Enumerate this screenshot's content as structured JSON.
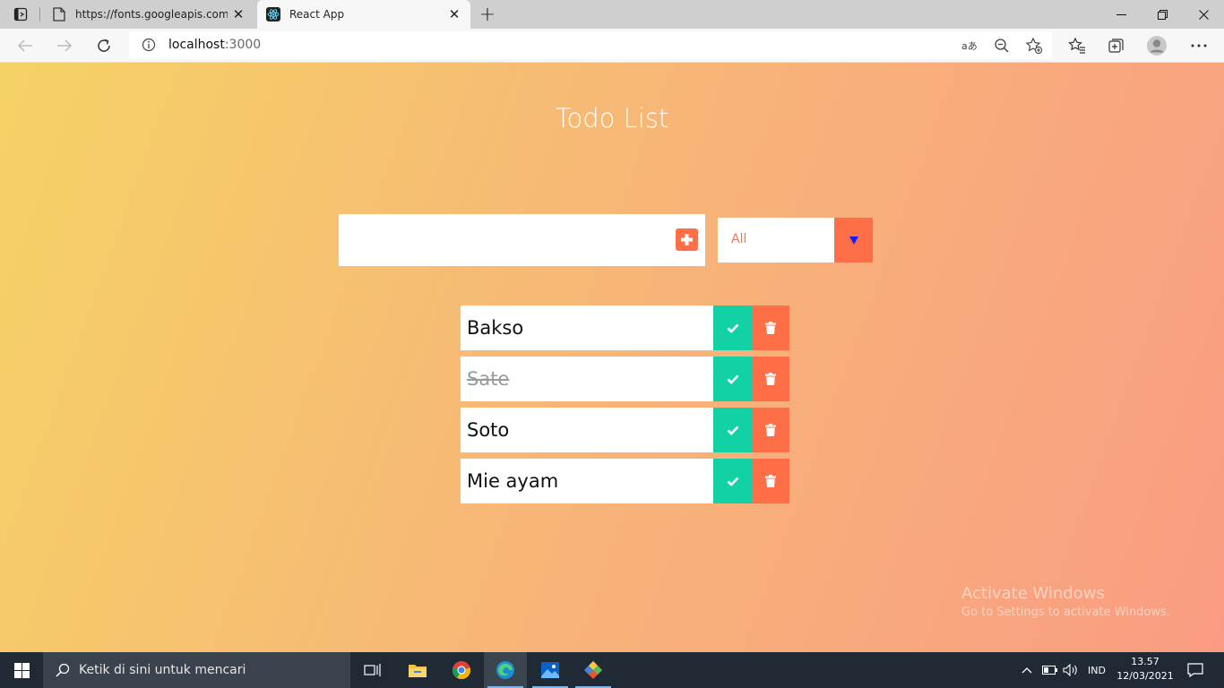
{
  "browser": {
    "tabs": [
      {
        "title": "https://fonts.googleapis.com/icc",
        "active": false
      },
      {
        "title": "React App",
        "active": true
      }
    ],
    "address": {
      "host": "localhost",
      "port": ":3000"
    }
  },
  "app": {
    "title": "Todo List",
    "input": {
      "value": "",
      "placeholder": ""
    },
    "filter": {
      "selected": "All"
    },
    "todos": [
      {
        "text": "Bakso",
        "completed": false
      },
      {
        "text": "Sate",
        "completed": true
      },
      {
        "text": "Soto",
        "completed": false
      },
      {
        "text": "Mie ayam",
        "completed": false
      }
    ],
    "colors": {
      "accent": "#ff6f47",
      "complete": "#12d2a5",
      "gradient_start": "#f5d265",
      "gradient_end": "#fa9c83"
    }
  },
  "watermark": {
    "line1": "Activate Windows",
    "line2": "Go to Settings to activate Windows."
  },
  "taskbar": {
    "search_placeholder": "Ketik di sini untuk mencari",
    "language": "IND",
    "time": "13.57",
    "date": "12/03/2021"
  }
}
